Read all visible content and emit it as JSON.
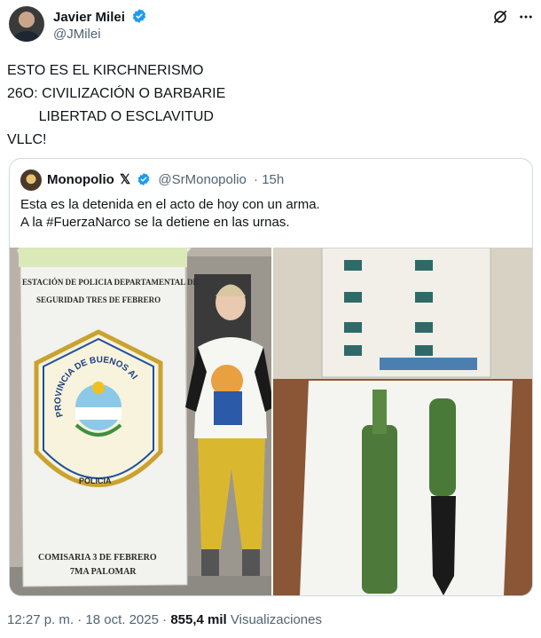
{
  "author": {
    "name": "Javier Milei",
    "handle": "@JMilei"
  },
  "tweet": {
    "text": "ESTO ES EL KIRCHNERISMO\n26O: CIVILIZACIÓN O BARBARIE\n        LIBERTAD O ESCLAVITUD\nVLLC!"
  },
  "quoted": {
    "name": "Monopolio",
    "badge": "𝕏",
    "handle": "@SrMonopolio",
    "time": "· 15h",
    "text": "Esta es la detenida en el acto de hoy con un arma.\nA la #FuerzaNarco se la detiene en las urnas.",
    "photo_left_sign": {
      "line1": "ESTACIÓN DE POLICIA DEPARTAMENTAL DE",
      "line2": "SEGURIDAD TRES DE FEBRERO",
      "shield_arc": "PROVINCIA DE BUENOS AIRES",
      "shield_bottom": "POLICIA",
      "line3": "COMISARIA 3 DE FEBRERO",
      "line4": "7MA PALOMAR"
    }
  },
  "meta": {
    "time": "12:27 p. m.",
    "separator": "·",
    "date": "18 oct. 2025",
    "views_count": "855,4 mil",
    "views_label": "Visualizaciones"
  },
  "colors": {
    "verified": "#1d9bf0",
    "muted": "#536471",
    "border": "#cfd9de"
  }
}
